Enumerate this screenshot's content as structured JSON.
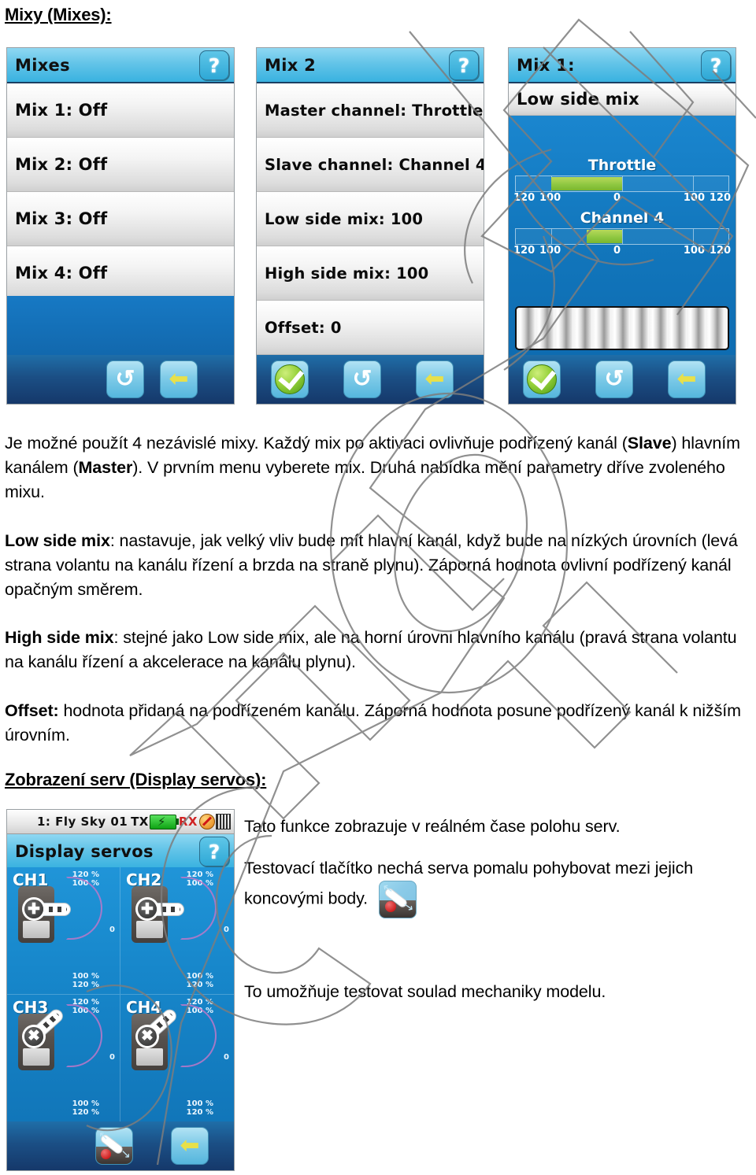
{
  "headings": {
    "mixy": "Mixy (Mixes):",
    "servos": "Zobrazení serv (Display servos):"
  },
  "body": {
    "p1_a": "Je možné použít 4 nezávislé mixy. Každý mix po aktivaci ovlivňuje podřízený kanál (",
    "p1_b": "Slave",
    "p1_c": ") hlavním kanálem (",
    "p1_d": "Master",
    "p1_e": "). V prvním menu vyberete mix. Druhá nabídka mění parametry dříve zvoleného mixu.",
    "p2_lead": "Low side mix",
    "p2_rest": ": nastavuje, jak velký vliv bude mít hlavní kanál, když bude na nízkých úrovních (levá strana volantu na kanálu řízení a brzda na straně plynu). Záporná hodnota ovlivní podřízený kanál opačným směrem.",
    "p3_lead": "High side mix",
    "p3_rest": ": stejné jako Low side mix, ale na horní úrovni hlavního kanálu (pravá strana volantu na kanálu řízení a akcelerace na kanálu plynu).",
    "p4_lead": "Offset:",
    "p4_rest": " hodnota přidaná na podřízeném kanálu. Záporná hodnota posune podřízený kanál k nižším úrovním.",
    "r1": "Tato funkce zobrazuje v reálném čase polohu serv.",
    "r2a": "Testovací tlačítko nechá serva pomalu pohybovat mezi jejich koncovými body.",
    "r3": "To umožňuje testovat soulad mechaniky modelu."
  },
  "screens": {
    "mixes": {
      "title": "Mixes",
      "help": "?",
      "rows": [
        "Mix 1: Off",
        "Mix 2: Off",
        "Mix 3: Off",
        "Mix 4: Off"
      ],
      "buttons": [
        "undo-button",
        "back-button"
      ]
    },
    "mix2": {
      "title": "Mix 2",
      "help": "?",
      "rows": [
        "Master channel: Throttle",
        "Slave channel: Channel 4",
        "Low side mix: 100",
        "High side mix: 100",
        "Offset: 0"
      ],
      "buttons": [
        "confirm-button",
        "undo-button",
        "back-button"
      ]
    },
    "mix1": {
      "title": "Mix 1:",
      "help": "?",
      "subtitle": "Low side mix",
      "buttons": [
        "confirm-button",
        "undo-button",
        "back-button"
      ]
    },
    "servos": {
      "model": "1: Fly Sky 01",
      "tx_label": "TX",
      "rx_label": "RX",
      "title": "Display servos",
      "help": "?",
      "channels": [
        {
          "label": "CH1",
          "top_pct": "120 %",
          "top_pct2": "100 %",
          "mid": "0",
          "bot_pct": "100 %",
          "bot_pct2": "120 %",
          "angle": 0
        },
        {
          "label": "CH2",
          "top_pct": "120 %",
          "top_pct2": "100 %",
          "mid": "0",
          "bot_pct": "100 %",
          "bot_pct2": "120 %",
          "angle": 0
        },
        {
          "label": "CH3",
          "top_pct": "120 %",
          "top_pct2": "100 %",
          "mid": "0",
          "bot_pct": "100 %",
          "bot_pct2": "120 %",
          "angle": -42
        },
        {
          "label": "CH4",
          "top_pct": "120 %",
          "top_pct2": "100 %",
          "mid": "0",
          "bot_pct": "100 %",
          "bot_pct2": "120 %",
          "angle": -42
        }
      ],
      "buttons": [
        "test-button",
        "back-button"
      ]
    }
  },
  "chart_data": {
    "type": "bar",
    "title": "Low side mix",
    "categories": [
      "Throttle",
      "Channel 4"
    ],
    "values": [
      -100,
      -50
    ],
    "xlabel": "",
    "ylabel": "",
    "xlim": [
      -120,
      120
    ],
    "tick_labels_left": [
      "120",
      "100"
    ],
    "tick_label_center": "0",
    "tick_labels_right": [
      "100",
      "120"
    ],
    "bar_color": "#8cc63f",
    "grid": true,
    "legend": "none"
  }
}
